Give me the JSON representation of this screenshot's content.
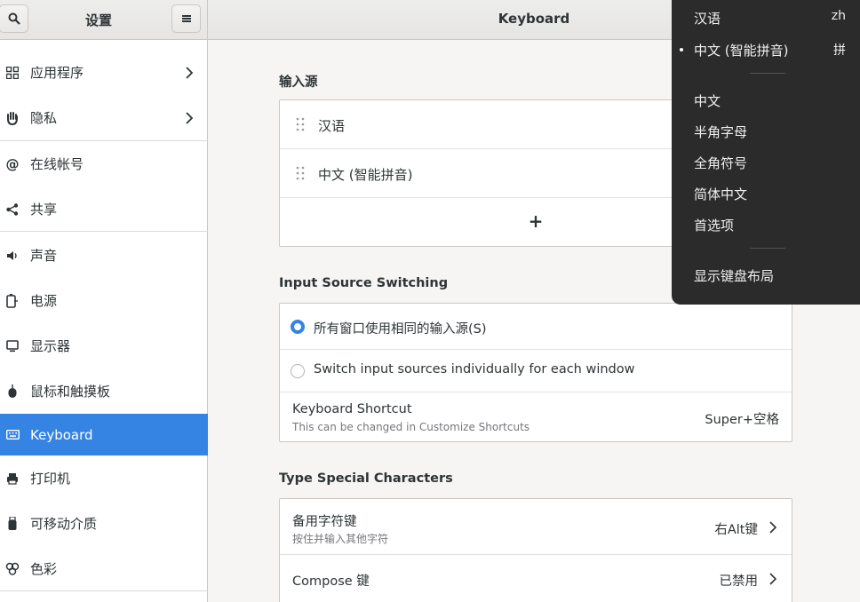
{
  "header": {
    "sidebar_title": "设置",
    "main_title": "Keyboard"
  },
  "sidebar": {
    "items": [
      {
        "label": "应用程序",
        "icon": "apps-grid-icon",
        "chevron": true
      },
      {
        "label": "隐私",
        "icon": "hand-icon",
        "chevron": true
      },
      {
        "label": "在线帐号",
        "icon": "at-icon"
      },
      {
        "label": "共享",
        "icon": "share-icon"
      },
      {
        "label": "声音",
        "icon": "speaker-icon"
      },
      {
        "label": "电源",
        "icon": "battery-icon"
      },
      {
        "label": "显示器",
        "icon": "monitor-icon"
      },
      {
        "label": "鼠标和触摸板",
        "icon": "mouse-icon"
      },
      {
        "label": "Keyboard",
        "icon": "keyboard-icon",
        "active": true
      },
      {
        "label": "打印机",
        "icon": "printer-icon"
      },
      {
        "label": "可移动介质",
        "icon": "usb-drive-icon"
      },
      {
        "label": "色彩",
        "icon": "palette-icon"
      }
    ]
  },
  "input_sources": {
    "title": "输入源",
    "items": [
      "汉语",
      "中文 (智能拼音)"
    ],
    "add_label": "+"
  },
  "switching": {
    "title": "Input Source Switching",
    "option_same": "所有窗口使用相同的输入源(S)",
    "option_individual": "Switch input sources individually for each window",
    "shortcut_label": "Keyboard Shortcut",
    "shortcut_sub": "This can be changed in Customize Shortcuts",
    "shortcut_value": "Super+空格"
  },
  "special": {
    "title": "Type Special Characters",
    "alt_label": "备用字符键",
    "alt_sub": "按住并输入其他字符",
    "alt_value": "右Alt键",
    "compose_label": "Compose 键",
    "compose_value": "已禁用"
  },
  "popover": {
    "sources": [
      {
        "label": "汉语",
        "tag": "zh"
      },
      {
        "label": "中文 (智能拼音)",
        "tag": "拼",
        "selected": true
      }
    ],
    "options": [
      "中文",
      "半角字母",
      "全角符号",
      "简体中文",
      "首选项"
    ],
    "show_layout": "显示键盘布局"
  },
  "colors": {
    "accent": "#3584e4",
    "popover_bg": "#2b2b2b"
  }
}
